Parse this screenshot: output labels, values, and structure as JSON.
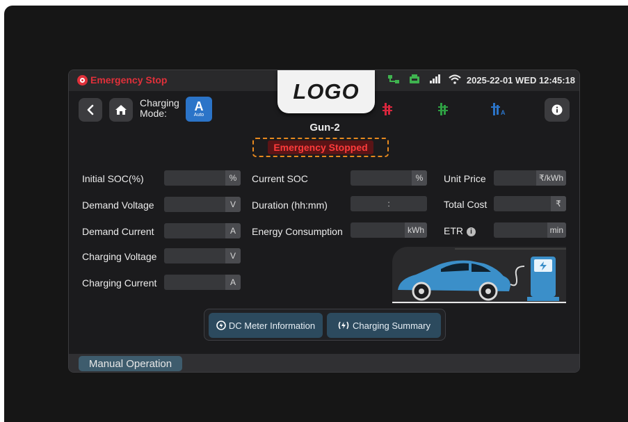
{
  "topbar": {
    "emergency_stop_label": "Emergency Stop",
    "datetime": "2025-22-01 WED 12:45:18",
    "status_icons": [
      "network-icon",
      "charger-station-icon",
      "signal-bars-icon",
      "wifi-icon"
    ]
  },
  "logo": "LOGO",
  "nav": {
    "charging_mode_label": "Charging Mode:",
    "mode_badge_letter": "A",
    "mode_badge_text": "Auto",
    "guns": [
      {
        "name": "gun-1",
        "color": "#d7263d",
        "suffix": ""
      },
      {
        "name": "gun-2",
        "color": "#2ea043",
        "suffix": ""
      },
      {
        "name": "gun-3",
        "color": "#2b74c8",
        "suffix": "A"
      }
    ]
  },
  "gun_title": "Gun-2",
  "status_badge": "Emergency Stopped",
  "fields": {
    "initial_soc": {
      "label": "Initial SOC(%)",
      "unit": "%",
      "value": ""
    },
    "demand_voltage": {
      "label": "Demand Voltage",
      "unit": "V",
      "value": ""
    },
    "demand_current": {
      "label": "Demand Current",
      "unit": "A",
      "value": ""
    },
    "charging_voltage": {
      "label": "Charging Voltage",
      "unit": "V",
      "value": ""
    },
    "charging_current": {
      "label": "Charging Current",
      "unit": "A",
      "value": ""
    },
    "current_soc": {
      "label": "Current SOC",
      "unit": "%",
      "value": ""
    },
    "duration": {
      "label": "Duration (hh:mm)",
      "unit": ":",
      "value": ""
    },
    "energy_consumption": {
      "label": "Energy Consumption",
      "unit": "kWh",
      "value": ""
    },
    "unit_price": {
      "label": "Unit Price",
      "unit": "₹/kWh",
      "value": ""
    },
    "total_cost": {
      "label": "Total Cost",
      "unit": "₹",
      "value": ""
    },
    "etr": {
      "label": "ETR",
      "unit": "min",
      "value": "",
      "info": "i"
    }
  },
  "buttons": {
    "dc_meter": "DC Meter Information",
    "charging_summary": "Charging Summary"
  },
  "manual_operation": "Manual Operation",
  "colors": {
    "emergency_red": "#e0303a",
    "badge_border": "#e98a1e",
    "accent_blue": "#2b74c8",
    "button_bg": "#2c4a5e",
    "car_color": "#3b8fc9"
  }
}
